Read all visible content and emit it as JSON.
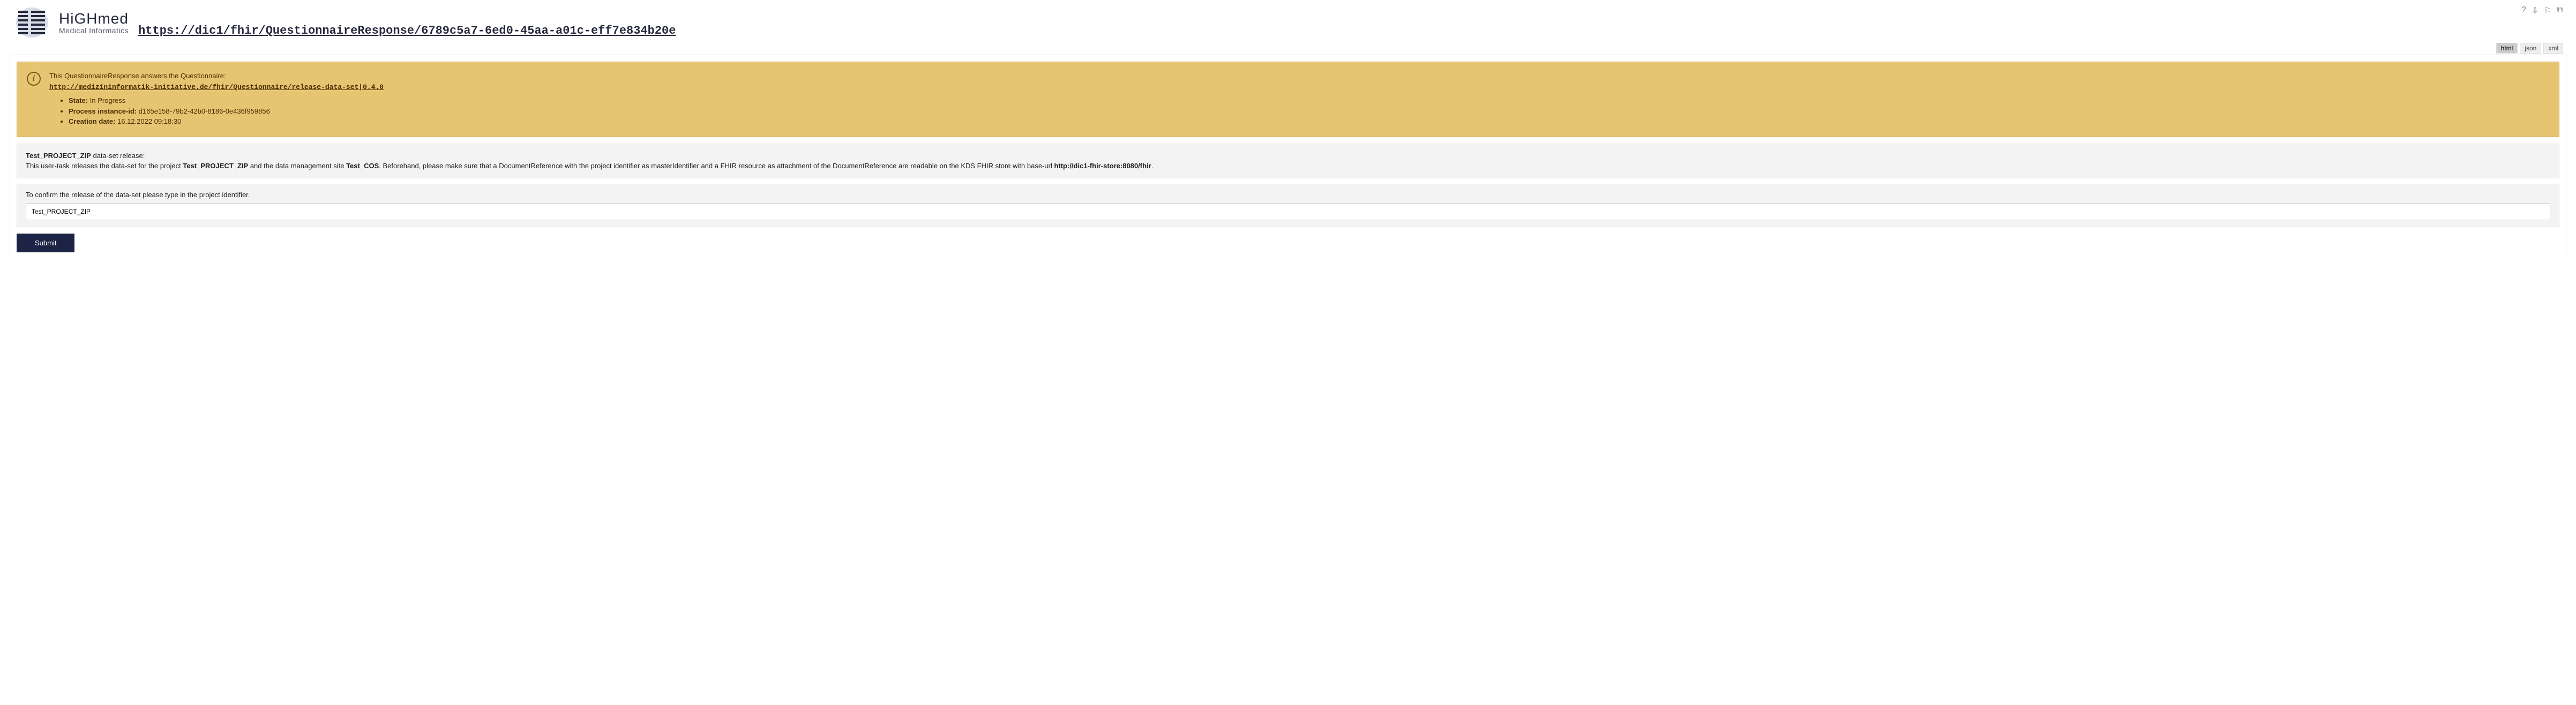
{
  "header": {
    "brand_hi": "Hi",
    "brand_gh": "GH",
    "brand_med": "med",
    "subtitle": "Medical Informatics",
    "resource_url": "https://dic1/fhir/QuestionnaireResponse/6789c5a7-6ed0-45aa-a01c-eff7e834b20e",
    "icons": {
      "help": "?",
      "download": "⇩",
      "bookmark": "⚐",
      "copy": "⧉"
    }
  },
  "format_tabs": {
    "html": "html",
    "json": "json",
    "xml": "xml",
    "active": "html"
  },
  "banner": {
    "intro": "This QuestionnaireResponse answers the Questionnaire:",
    "questionnaire_url": "http://medizininformatik-initiative.de/fhir/Questionnaire/release-data-set|0.4.0",
    "state_label": "State:",
    "state_value": "In Progress",
    "process_label": "Process instance-id:",
    "process_value": "d165e158-79b2-42b0-8186-0e436f959856",
    "creation_label": "Creation date:",
    "creation_value": "16.12.2022 09:18:30"
  },
  "release": {
    "project": "Test_PROJECT_ZIP",
    "title_suffix": " data-set release:",
    "pre_text": "This user-task releases the data-set for the project ",
    "mid_text": " and the data management site ",
    "cos": "Test_COS",
    "post_text": ". Beforehand, please make sure that a DocumentReference with the project identifier as masterIdentifier and a FHIR resource as attachment of the DocumentReference are readable on the KDS FHIR store with base-url ",
    "base_url": "http://dic1-fhir-store:8080/fhir",
    "tail": "."
  },
  "confirm": {
    "label": "To confirm the release of the data-set please type in the project identifier.",
    "value": "Test_PROJECT_ZIP"
  },
  "buttons": {
    "submit": "Submit"
  }
}
